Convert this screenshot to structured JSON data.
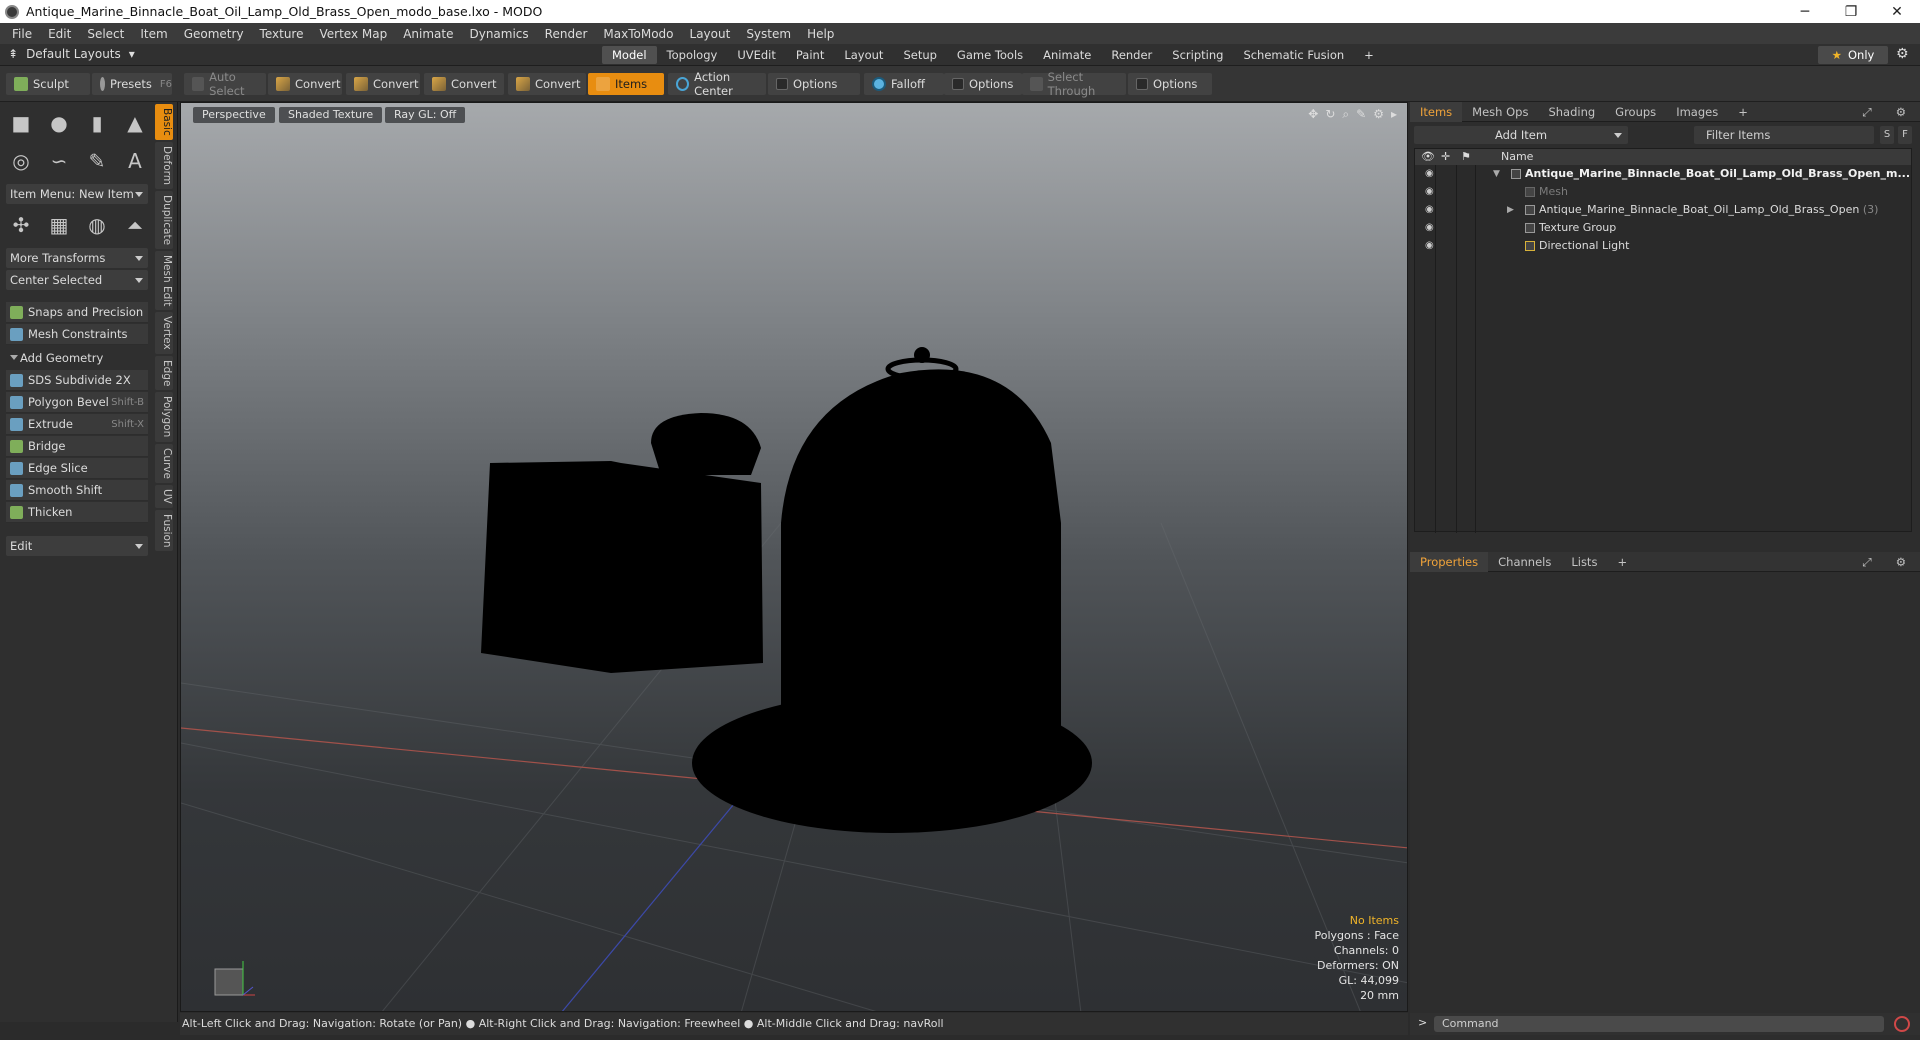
{
  "window": {
    "title": "Antique_Marine_Binnacle_Boat_Oil_Lamp_Old_Brass_Open_modo_base.lxo - MODO",
    "min": "─",
    "max": "❐",
    "close": "✕"
  },
  "menu": [
    "File",
    "Edit",
    "Select",
    "Item",
    "Geometry",
    "Texture",
    "Vertex Map",
    "Animate",
    "Dynamics",
    "Render",
    "MaxToModo",
    "Layout",
    "System",
    "Help"
  ],
  "layoutbar": {
    "layout_select": "Default Layouts",
    "tabs": [
      "Model",
      "Topology",
      "UVEdit",
      "Paint",
      "Layout",
      "Setup",
      "Game Tools",
      "Animate",
      "Render",
      "Scripting",
      "Schematic Fusion",
      "+"
    ],
    "active_tab": "Model",
    "only_label": "Only"
  },
  "toolbar": {
    "sculpt": "Sculpt",
    "presets": "Presets",
    "presets_key": "F6",
    "auto_select": "Auto Select",
    "convert1": "Convert",
    "convert2": "Convert",
    "convert3": "Convert",
    "convert4": "Convert",
    "items": "Items",
    "action_center": "Action Center",
    "options1": "Options",
    "falloff": "Falloff",
    "options2": "Options",
    "select_through": "Select Through",
    "options3": "Options"
  },
  "leftpanel": {
    "item_menu": "Item Menu: New Item",
    "more_transforms": "More Transforms",
    "center_selected": "Center Selected",
    "snaps": "Snaps and Precision",
    "mesh_constraints": "Mesh Constraints",
    "add_geometry": "Add Geometry",
    "tools": [
      {
        "label": "SDS Subdivide 2X",
        "key": ""
      },
      {
        "label": "Polygon Bevel",
        "key": "Shift-B"
      },
      {
        "label": "Extrude",
        "key": "Shift-X"
      },
      {
        "label": "Bridge",
        "key": ""
      },
      {
        "label": "Edge Slice",
        "key": ""
      },
      {
        "label": "Smooth Shift",
        "key": ""
      },
      {
        "label": "Thicken",
        "key": ""
      }
    ],
    "edit_dropdown": "Edit",
    "vtabs": [
      "Basic",
      "Deform",
      "Duplicate",
      "Mesh Edit",
      "Vertex",
      "Edge",
      "Polygon",
      "Curve",
      "UV",
      "Fusion"
    ]
  },
  "viewport": {
    "perspective": "Perspective",
    "shading": "Shaded Texture",
    "raygl": "Ray GL: Off",
    "info": {
      "no_items": "No Items",
      "polygons": "Polygons : Face",
      "channels": "Channels: 0",
      "deformers": "Deformers: ON",
      "gl": "GL: 44,099",
      "scale": "20 mm"
    }
  },
  "statusbar": "Alt-Left Click and Drag: Navigation: Rotate (or Pan) ● Alt-Right Click and Drag: Navigation: Freewheel ● Alt-Middle Click and Drag: navRoll",
  "items_panel": {
    "tabs": [
      "Items",
      "Mesh Ops",
      "Shading",
      "Groups",
      "Images",
      "+"
    ],
    "active_tab": "Items",
    "add_item": "Add Item",
    "filter": "Filter Items",
    "btn_s": "S",
    "btn_f": "F",
    "col_name": "Name",
    "rows": [
      {
        "label": "Antique_Marine_Binnacle_Boat_Oil_Lamp_Old_Brass_Open_m...",
        "count": ""
      },
      {
        "label": "Mesh",
        "count": ""
      },
      {
        "label": "Antique_Marine_Binnacle_Boat_Oil_Lamp_Old_Brass_Open",
        "count": "(3)"
      },
      {
        "label": "Texture Group",
        "count": ""
      },
      {
        "label": "Directional Light",
        "count": ""
      }
    ]
  },
  "properties_panel": {
    "tabs": [
      "Properties",
      "Channels",
      "Lists",
      "+"
    ],
    "active_tab": "Properties"
  },
  "command": {
    "placeholder": "Command"
  }
}
